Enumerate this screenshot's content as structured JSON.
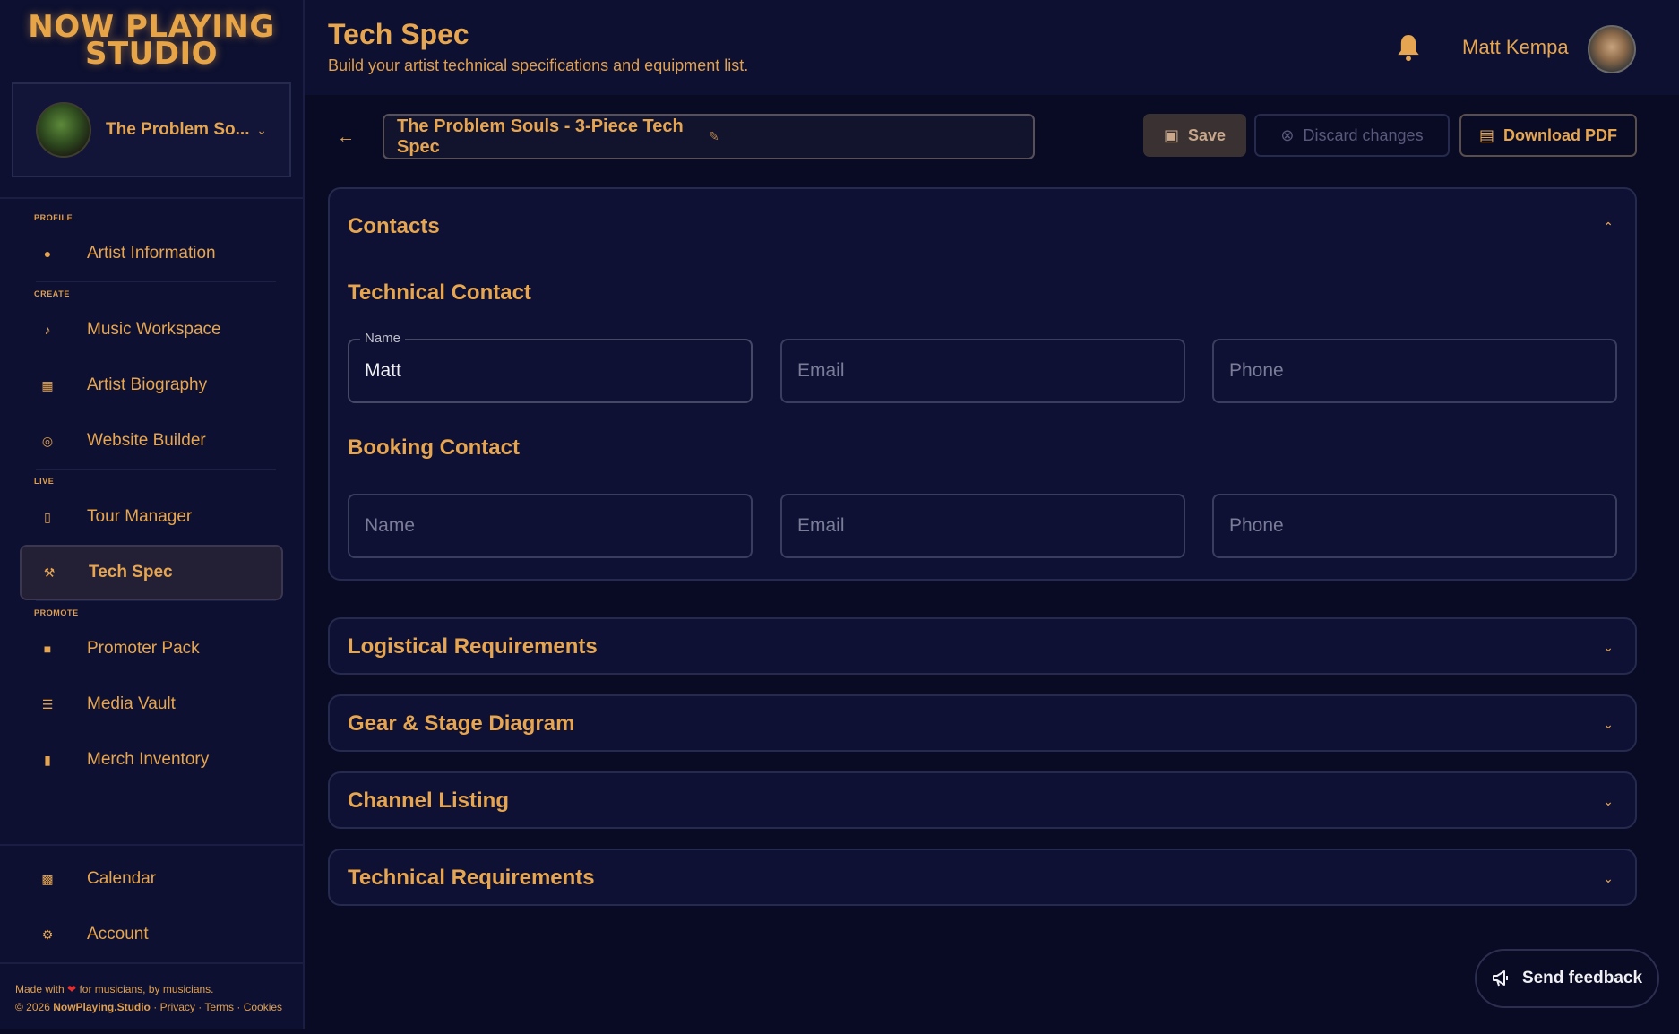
{
  "brand": {
    "logo_line1": "NOW PLAYING",
    "logo_line2": "STUDIO"
  },
  "artist_switcher": {
    "name": "The Problem So..."
  },
  "sidebar": {
    "sections": {
      "profile": "PROFILE",
      "create": "CREATE",
      "live": "LIVE",
      "promote": "PROMOTE"
    },
    "items": {
      "artist_information": "Artist Information",
      "music_workspace": "Music Workspace",
      "artist_biography": "Artist Biography",
      "website_builder": "Website Builder",
      "tour_manager": "Tour Manager",
      "tech_spec": "Tech Spec",
      "promoter_pack": "Promoter Pack",
      "media_vault": "Media Vault",
      "merch_inventory": "Merch Inventory",
      "calendar": "Calendar",
      "account": "Account"
    },
    "active_item": "tech_spec",
    "footer": {
      "made_with_pre": "Made with",
      "made_with_post": "for musicians, by musicians.",
      "copyright_pre": "© 2026",
      "brand_link": "NowPlaying.Studio",
      "privacy": "Privacy",
      "terms": "Terms",
      "cookies": "Cookies"
    }
  },
  "header": {
    "title": "Tech Spec",
    "subtitle": "Build your artist technical specifications and equipment list.",
    "user_name": "Matt Kempa"
  },
  "toolbar": {
    "spec_title": "The Problem Souls - 3-Piece Tech Spec",
    "save_label": "Save",
    "discard_label": "Discard changes",
    "download_label": "Download PDF"
  },
  "contacts": {
    "heading": "Contacts",
    "technical": {
      "heading": "Technical Contact",
      "name_label": "Name",
      "name_value": "Matt",
      "email_placeholder": "Email",
      "phone_placeholder": "Phone"
    },
    "booking": {
      "heading": "Booking Contact",
      "name_placeholder": "Name",
      "email_placeholder": "Email",
      "phone_placeholder": "Phone"
    }
  },
  "sections": {
    "logistical": "Logistical Requirements",
    "gear": "Gear & Stage Diagram",
    "channel": "Channel Listing",
    "technical": "Technical Requirements"
  },
  "feedback_label": "Send feedback",
  "colors": {
    "accent": "#e6a550",
    "background": "#090b24",
    "panel": "#0e1133",
    "sidebar": "#0d1030"
  }
}
